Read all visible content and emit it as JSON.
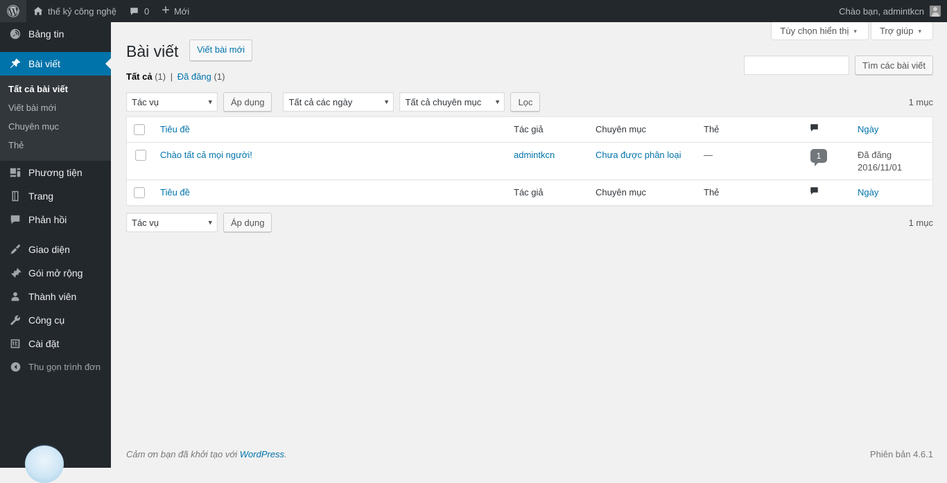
{
  "adminbar": {
    "wp_logo": "wordpress-logo-icon",
    "site_name": "thế kỷ công nghệ",
    "home_icon": "home-icon",
    "comments_icon": "comment-bubble-icon",
    "comments_count": "0",
    "new_icon": "plus-icon",
    "new_label": "Mới",
    "greeting": "Chào bạn, admintkcn",
    "avatar": "user-avatar-icon"
  },
  "sidebar": {
    "items": [
      {
        "label": "Bảng tin",
        "icon": "dashboard-icon",
        "current": false
      },
      {
        "label": "Bài viết",
        "icon": "pin-icon",
        "current": true
      },
      {
        "label": "Phương tiện",
        "icon": "media-icon",
        "current": false
      },
      {
        "label": "Trang",
        "icon": "page-icon",
        "current": false
      },
      {
        "label": "Phản hồi",
        "icon": "comment-icon",
        "current": false
      },
      {
        "label": "Giao diện",
        "icon": "appearance-brush-icon",
        "current": false
      },
      {
        "label": "Gói mở rộng",
        "icon": "plugin-plug-icon",
        "current": false
      },
      {
        "label": "Thành viên",
        "icon": "users-icon",
        "current": false
      },
      {
        "label": "Công cụ",
        "icon": "wrench-icon",
        "current": false
      },
      {
        "label": "Cài đặt",
        "icon": "settings-sliders-icon",
        "current": false
      }
    ],
    "submenu": [
      {
        "label": "Tất cả bài viết",
        "current": true
      },
      {
        "label": "Viết bài mới",
        "current": false
      },
      {
        "label": "Chuyên mục",
        "current": false
      },
      {
        "label": "Thẻ",
        "current": false
      }
    ],
    "collapse": {
      "label": "Thu gọn trình đơn",
      "icon": "collapse-arrow-icon"
    }
  },
  "screen_meta": {
    "screen_options": "Tùy chọn hiển thị",
    "help": "Trợ giúp",
    "caret": "▾"
  },
  "page": {
    "title": "Bài viết",
    "add_new": "Viết bài mới"
  },
  "search": {
    "value": "",
    "placeholder": "",
    "submit": "Tìm các bài viết"
  },
  "views": {
    "all_label": "Tất cả",
    "all_count": "(1)",
    "separator": "|",
    "published_label": "Đã đăng",
    "published_count": "(1)"
  },
  "tablenav_top": {
    "bulk_action": "Tác vụ",
    "apply": "Áp dụng",
    "date_filter": "Tất cả các ngày",
    "category_filter": "Tất cả chuyên mục",
    "filter_button": "Lọc",
    "displaying_num": "1 mục"
  },
  "tablenav_bottom": {
    "bulk_action": "Tác vụ",
    "apply": "Áp dụng",
    "displaying_num": "1 mục"
  },
  "table": {
    "columns": {
      "cb": "select-all-checkbox",
      "title": "Tiêu đề",
      "author": "Tác giả",
      "categories": "Chuyên mục",
      "tags": "Thẻ",
      "comments": "comment-bubble-icon",
      "date": "Ngày"
    },
    "rows": [
      {
        "title": "Chào tất cả mọi người!",
        "author": "admintkcn",
        "categories": "Chưa được phân loại",
        "tags": "—",
        "comments": "1",
        "date_status": "Đã đăng",
        "date_value": "2016/11/01"
      }
    ]
  },
  "footer": {
    "thankyou_prefix": "Cảm ơn bạn đã khởi tạo với ",
    "thankyou_link": "WordPress",
    "thankyou_suffix": ".",
    "version": "Phiên bản 4.6.1"
  },
  "colors": {
    "sidebar_bg": "#23282d",
    "submenu_bg": "#32373c",
    "accent": "#0073aa",
    "link": "#0073aa",
    "page_bg": "#f1f1f1",
    "table_bg": "#ffffff",
    "comment_badge": "#72777c"
  }
}
